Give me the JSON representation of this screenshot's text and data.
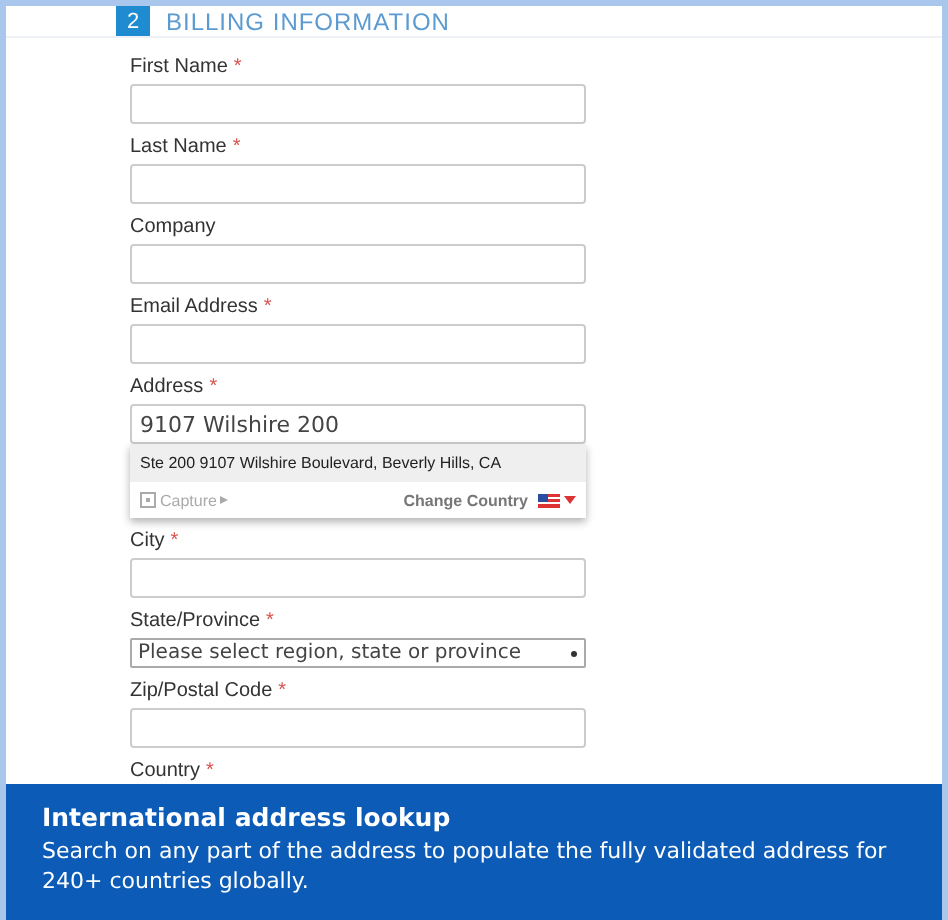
{
  "section": {
    "step": "2",
    "title": "BILLING INFORMATION"
  },
  "fields": [
    {
      "kind": "text",
      "label": "First Name",
      "marker": "*"
    },
    {
      "kind": "text",
      "label": "Last Name",
      "marker": "*"
    },
    {
      "kind": "text",
      "label": "Company"
    },
    {
      "kind": "text",
      "label": "Email Address",
      "marker": "*"
    },
    {
      "kind": "text",
      "label": "Address",
      "marker": "*",
      "value": "9107 Wilshire 200",
      "suggestions": {
        "items": [
          "Ste 200 9107 Wilshire Boulevard, Beverly Hills, CA"
        ],
        "capture": "Capture",
        "change_country": "Change Country"
      }
    },
    {
      "kind": "text",
      "label": "City",
      "marker": "*"
    },
    {
      "kind": "select",
      "label": "State/Province",
      "marker": "*",
      "value": "Please select region, state or province"
    },
    {
      "kind": "text",
      "label": "Zip/Postal Code",
      "marker": "*"
    },
    {
      "kind": "label",
      "label": "Country",
      "marker": "*"
    }
  ],
  "banner": {
    "title": "International address lookup",
    "text": "Search on any part of the address to populate the fully validated address for 240+ countries globally."
  }
}
